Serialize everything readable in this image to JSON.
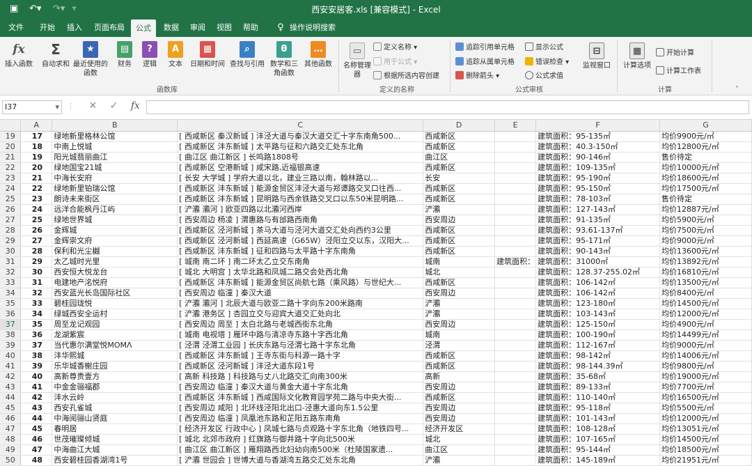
{
  "title": "西安安居客.xls  [兼容模式]  -  Excel",
  "tabs": [
    "文件",
    "开始",
    "插入",
    "页面布局",
    "公式",
    "数据",
    "审阅",
    "视图",
    "帮助",
    "操作说明搜索"
  ],
  "ribbon": {
    "insert_function": "插入函数",
    "autosum": "自动求和",
    "recent": "最近使用的函数",
    "financial": "财务",
    "logical": "逻辑",
    "text": "文本",
    "datetime": "日期和时间",
    "lookup": "查找与引用",
    "math": "数学和三角函数",
    "more": "其他函数",
    "library_group": "函数库",
    "name_manager": "名称管理器",
    "define_name": "定义名称",
    "use_in_formula": "用于公式",
    "create_from_sel": "根据所选内容创建",
    "names_group": "定义的名称",
    "trace_prec": "追踪引用单元格",
    "trace_dep": "追踪从属单元格",
    "remove_arrows": "删除箭头",
    "show_formulas": "显示公式",
    "error_check": "错误检查",
    "evaluate": "公式求值",
    "watch": "监视窗口",
    "audit_group": "公式审核",
    "calc_options": "计算选项",
    "calc_now": "开始计算",
    "calc_sheet": "计算工作表",
    "calc_group": "计算"
  },
  "namebox": "I37",
  "fx": "fx",
  "columns": [
    "A",
    "B",
    "C",
    "D",
    "E",
    "F",
    "G"
  ],
  "rows": [
    {
      "r": "19",
      "a": "17",
      "b": "绿地新里格林公馆",
      "c": "[ 西咸新区 秦汉新城 ] 沣泾大道与秦汉大道交汇十字东南角500...",
      "d": "西咸新区",
      "e": "",
      "f": "建筑面积：95-135㎡",
      "g": "均价9900元/㎡"
    },
    {
      "r": "20",
      "a": "18",
      "b": "中南上悦城",
      "c": "[ 西咸新区 沣东新城 ] 太平路与征和六路交汇处东北角",
      "d": "西咸新区",
      "e": "",
      "f": "建筑面积：40.3-150㎡",
      "g": "均价12800元/㎡"
    },
    {
      "r": "21",
      "a": "19",
      "b": "阳光城翡丽曲江",
      "c": "[ 曲江区 曲江新区 ] 长鸣路1808号",
      "d": "曲江区",
      "e": "",
      "f": "建筑面积：90-146㎡",
      "g": "售价待定"
    },
    {
      "r": "22",
      "a": "20",
      "b": "绿地国宝21城",
      "c": "[ 西咸新区 空港新城 ] 咸宋路,近福银高速",
      "d": "西咸新区",
      "e": "",
      "f": "建筑面积：109-135㎡",
      "g": "均价10000元/㎡"
    },
    {
      "r": "23",
      "a": "21",
      "b": "中海长安府",
      "c": "[ 长安 大学城 ] 学府大道以北，建业三路以南，翰林路以...",
      "d": "长安",
      "e": "",
      "f": "建筑面积：95-190㎡",
      "g": "均价18600元/㎡"
    },
    {
      "r": "24",
      "a": "22",
      "b": "绿地新里铂瑞公馆",
      "c": "[ 西咸新区 沣东新城 ] 能源金贸区沣泾大道与郑谭路交叉口往西...",
      "d": "西咸新区",
      "e": "",
      "f": "建筑面积：95-150㎡",
      "g": "均价17500元/㎡"
    },
    {
      "r": "25",
      "a": "23",
      "b": "朗诗未来街区",
      "c": "[ 西咸新区 沣东新城 ] 昆明路与西余铁路交叉口以东50米昆明路...",
      "d": "西咸新区",
      "e": "",
      "f": "建筑面积：78-103㎡",
      "g": "售价待定"
    },
    {
      "r": "26",
      "a": "24",
      "b": "远洋合能枫丹江屿",
      "c": "[ 浐灞 灞河 ] 欧亚四路以北灞河西岸",
      "d": "浐灞",
      "e": "",
      "f": "建筑面积：127-143㎡",
      "g": "均价12887元/㎡"
    },
    {
      "r": "27",
      "a": "25",
      "b": "绿地世界城",
      "c": "[ 西安周边 杨凌 ] 渭惠路与有邰路西南角",
      "d": "西安周边",
      "e": "",
      "f": "建筑面积：91-135㎡",
      "g": "均价5900元/㎡"
    },
    {
      "r": "28",
      "a": "26",
      "b": "金辉城",
      "c": "[ 西咸新区 泾河新城 ] 茶马大道与泾河大道交汇处向西约3公里",
      "d": "西咸新区",
      "e": "",
      "f": "建筑面积：93.61-137㎡",
      "g": "均价7500元/㎡"
    },
    {
      "r": "29",
      "a": "27",
      "b": "金辉崇文府",
      "c": "[ 西咸新区 泾河新城 ] 西延高速（G65W）泾阳立交以东，汉阳大...",
      "d": "西咸新区",
      "e": "",
      "f": "建筑面积：95-171㎡",
      "g": "均价9000元/㎡"
    },
    {
      "r": "30",
      "a": "28",
      "b": "保利和光尘樾",
      "c": "[ 西咸新区 沣东新城 ] 征和四路与太平路十字东南角",
      "d": "西咸新区",
      "e": "",
      "f": "建筑面积：90-143㎡",
      "g": "均价13600元/㎡"
    },
    {
      "r": "31",
      "a": "29",
      "b": "太乙城时光里",
      "c": "[ 城南 南二环 ] 南二环太乙立交东南角",
      "d": "城南",
      "e": "建筑面积：",
      "f": "建筑面积：31000㎡",
      "g": "均价13892元/㎡"
    },
    {
      "r": "32",
      "a": "30",
      "b": "西安恒大悦龙台",
      "c": "[ 城北 大明宫 ] 太华北路和凤城二路交会处西北角",
      "d": "城北",
      "e": "",
      "f": "建筑面积：128.37-255.02㎡",
      "g": "均价16810元/㎡"
    },
    {
      "r": "33",
      "a": "31",
      "b": "电建地产洺悦府",
      "c": "[ 西咸新区 沣东新城 ] 能源金贸区尚航七路（乘风路）与世纪大...",
      "d": "西咸新区",
      "e": "",
      "f": "建筑面积：106-142㎡",
      "g": "均价13500元/㎡"
    },
    {
      "r": "34",
      "a": "32",
      "b": "西安蓝光长岛国际社区",
      "c": "[ 西安周边 临潼 ] 秦汉大道",
      "d": "西安周边",
      "e": "",
      "f": "建筑面积：106-142㎡",
      "g": "均价8400元/㎡"
    },
    {
      "r": "35",
      "a": "33",
      "b": "碧桂园珑悦",
      "c": "[ 浐灞 灞河 ] 北辰大道与欧亚二路十字向东200米路南",
      "d": "浐灞",
      "e": "",
      "f": "建筑面积：123-180㎡",
      "g": "均价14500元/㎡"
    },
    {
      "r": "36",
      "a": "34",
      "b": "绿城西安全运村",
      "c": "[ 浐灞 港务区 ] 杏园立交与迎宾大道交汇处向北",
      "d": "浐灞",
      "e": "",
      "f": "建筑面积：103-143㎡",
      "g": "均价12000元/㎡"
    },
    {
      "r": "37",
      "a": "35",
      "b": "周至龙记观园",
      "c": "[ 西安周边 周至 ] 太白北路与老城西街东北角",
      "d": "西安周边",
      "e": "",
      "f": "建筑面积：125-150㎡",
      "g": "均价4900元/㎡"
    },
    {
      "r": "38",
      "a": "36",
      "b": "龙湖紫宸",
      "c": "[ 城南 电视塔 ] 雁环中路与清凉寺东路十字西北角",
      "d": "城南",
      "e": "",
      "f": "建筑面积：100-190㎡",
      "g": "均价14499元/㎡"
    },
    {
      "r": "39",
      "a": "37",
      "b": "当代惠尔满堂悦MOMΛ",
      "c": "[ 泾渭 泾渭工业园 ] 长庆东路与泾渭七路十字东北角",
      "d": "泾渭",
      "e": "",
      "f": "建筑面积：112-167㎡",
      "g": "均价9000元/㎡"
    },
    {
      "r": "40",
      "a": "38",
      "b": "沣华熙城",
      "c": "[ 西咸新区 沣东新城 ] 王寺东街与科源一路十字",
      "d": "西咸新区",
      "e": "",
      "f": "建筑面积：98-142㎡",
      "g": "均价14006元/㎡"
    },
    {
      "r": "41",
      "a": "39",
      "b": "乐华城香榭庄园",
      "c": "[ 西咸新区 泾河新城 ] 沣泾大道东段1号",
      "d": "西咸新区",
      "e": "",
      "f": "建筑面积：98-144.39㎡",
      "g": "均价9800元/㎡"
    },
    {
      "r": "42",
      "a": "40",
      "b": "高新尊贵壹方",
      "c": "[ 高新 科技路 ] 科技路与丈八北路交汇向南300米",
      "d": "高新",
      "e": "",
      "f": "建筑面积：35-68㎡",
      "g": "均价19000元/㎡"
    },
    {
      "r": "43",
      "a": "41",
      "b": "中金金骊福郡",
      "c": "[ 西安周边 临潼 ] 秦汉大道与黄金大道十字东北角",
      "d": "西安周边",
      "e": "",
      "f": "建筑面积：89-133㎡",
      "g": "均价7700元/㎡"
    },
    {
      "r": "44",
      "a": "42",
      "b": "沣水云岭",
      "c": "[ 西咸新区 沣东新城 ] 西咸国际文化教育园学苑二路与中央大街...",
      "d": "西咸新区",
      "e": "",
      "f": "建筑面积：110-140㎡",
      "g": "均价16500元/㎡"
    },
    {
      "r": "45",
      "a": "43",
      "b": "西安孔雀城",
      "c": "[ 西安周边 咸阳 ] 北环线泾阳北出口-泾惠大道向东1.5公里",
      "d": "西安周边",
      "e": "",
      "f": "建筑面积：95-118㎡",
      "g": "均价5500元/㎡"
    },
    {
      "r": "46",
      "a": "44",
      "b": "中海阅骊山贤庭",
      "c": "[ 西安周边 临潼 ] 凤凰池东路和芷阳五路东南角",
      "d": "西安周边",
      "e": "",
      "f": "建筑面积：101-143㎡",
      "g": "均价12000元/㎡"
    },
    {
      "r": "47",
      "a": "45",
      "b": "春明居",
      "c": "[ 经济开发区 行政中心 ] 凤城七路与贞观路十字东北角（地铁四号...",
      "d": "经济开发区",
      "e": "",
      "f": "建筑面积：108-128㎡",
      "g": "均价13051元/㎡"
    },
    {
      "r": "48",
      "a": "46",
      "b": "世茂璀璨倾城",
      "c": "[ 城北 北郊市政府 ] 红旗路与御井路十字向北500米",
      "d": "城北",
      "e": "",
      "f": "建筑面积：107-165㎡",
      "g": "均价14500元/㎡"
    },
    {
      "r": "49",
      "a": "47",
      "b": "中海曲江大城",
      "c": "[ 曲江区 曲江新区 ] 雁翔路西北妇幼向南500米（杜陵国家遗...",
      "d": "曲江区",
      "e": "",
      "f": "建筑面积：95-144㎡",
      "g": "均价18500元/㎡"
    },
    {
      "r": "50",
      "a": "48",
      "b": "西安碧桂园香湖湾1号",
      "c": "[ 浐灞 世园会 ] 世博大道与香湖湾五路交汇处东北角",
      "d": "浐灞",
      "e": "",
      "f": "建筑面积：145-189㎡",
      "g": "均价21951元/㎡"
    }
  ]
}
